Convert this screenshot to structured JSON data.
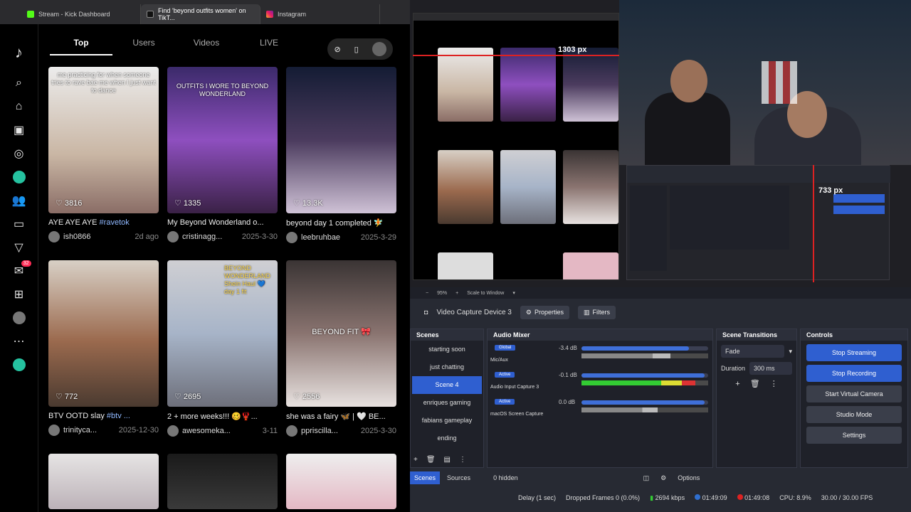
{
  "browser": {
    "tabs": [
      {
        "label": "Stream - Kick Dashboard",
        "icon": "kick-icon"
      },
      {
        "label": "Find 'beyond outfits women' on TikT...",
        "icon": "tiktok-icon"
      },
      {
        "label": "Instagram",
        "icon": "instagram-icon"
      }
    ]
  },
  "tiktok": {
    "sidebar_badge": "32",
    "tabs": [
      "Top",
      "Users",
      "Videos",
      "LIVE"
    ],
    "videos": [
      {
        "caption": "me practicing for when someone tries to rave bae me when I just want to dance",
        "likes": "3816",
        "title": "AYE AYE AYE ",
        "tag": "#ravetok",
        "user": "ish0866",
        "date": "2d ago"
      },
      {
        "caption": "OUTFITS I WORE TO BEYOND WONDERLAND",
        "likes": "1335",
        "title": "My Beyond Wonderland o...",
        "tag": "",
        "user": "cristinagg...",
        "date": "2025-3-30"
      },
      {
        "caption": "",
        "likes": "13.3K",
        "title": "beyond day 1 completed 🧚",
        "tag": "",
        "user": "leebruhbae",
        "date": "2025-3-29"
      },
      {
        "caption": "",
        "likes": "772",
        "title": "BTV OOTD slay ",
        "tag": "#btv ...",
        "user": "trinityca...",
        "date": "2025-12-30"
      },
      {
        "caption": "BEYOND WONDERLAND Shein Haul 💙 day 1 fit",
        "likes": "2695",
        "title": "2 + more weeks!!! 🥴🦞...",
        "tag": "",
        "user": "awesomeka...",
        "date": "3-11"
      },
      {
        "caption": "BEYOND FIT 🎀",
        "likes": "2556",
        "title": "she was a fairy 🦋 | 🤍 BE...",
        "tag": "",
        "user": "ppriscilla...",
        "date": "2025-3-30"
      }
    ]
  },
  "preview": {
    "measure_top": "1303 px",
    "measure_right": "733 px"
  },
  "obs": {
    "zoom": "95%",
    "scale_mode": "Scale to Window",
    "source_name": "Video Capture Device 3",
    "properties_label": "Properties",
    "filters_label": "Filters",
    "scenes_title": "Scenes",
    "scenes": [
      "starting soon",
      "just chatting",
      "Scene 4",
      "enriques gaming",
      "fabians gameplay",
      "ending"
    ],
    "selected_scene": "Scene 4",
    "mixer_title": "Audio Mixer",
    "channels": [
      {
        "tag": "Global",
        "name": "Mic/Aux",
        "db": "-3.4 dB",
        "vol": 0.85,
        "level": 0.7
      },
      {
        "tag": "Active",
        "name": "Audio Input Capture 3",
        "db": "-0.1 dB",
        "vol": 0.97,
        "level": 0.9
      },
      {
        "tag": "Active",
        "name": "macOS Screen Capture",
        "db": "0.0 dB",
        "vol": 0.97,
        "level": 0.6
      }
    ],
    "transitions_title": "Scene Transitions",
    "transition": "Fade",
    "duration_label": "Duration",
    "duration": "300 ms",
    "controls_title": "Controls",
    "controls": [
      "Stop Streaming",
      "Stop Recording",
      "Start Virtual Camera",
      "Studio Mode",
      "Settings"
    ],
    "bottom_tabs": [
      "Scenes",
      "Sources"
    ],
    "hidden": "0 hidden",
    "options": "Options",
    "status": {
      "delay": "Delay (1 sec)",
      "dropped": "Dropped Frames 0 (0.0%)",
      "bitrate": "2694 kbps",
      "live_time": "01:49:09",
      "rec_time": "01:49:08",
      "cpu": "CPU: 8.9%",
      "fps": "30.00 / 30.00 FPS"
    }
  }
}
